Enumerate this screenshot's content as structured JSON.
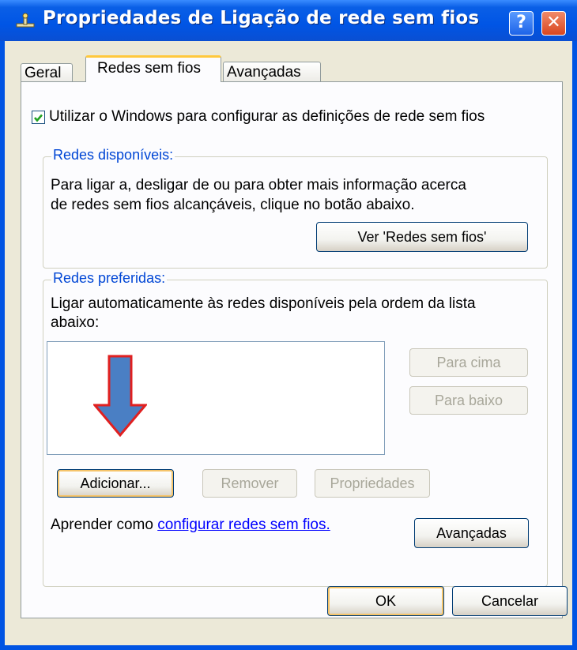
{
  "window": {
    "title": "Propriedades de Ligação de rede sem fios",
    "help_glyph": "?",
    "close_glyph": "✕"
  },
  "tabs": [
    {
      "label": "Geral"
    },
    {
      "label": "Redes sem fios"
    },
    {
      "label": "Avançadas"
    }
  ],
  "checkbox": {
    "label": "Utilizar o Windows para configurar as definições de rede sem fios",
    "checked": true
  },
  "available": {
    "legend": "Redes disponíveis:",
    "text_line1": "Para ligar a, desligar de ou para obter mais informação acerca",
    "text_line2": "de redes sem fios alcançáveis, clique no botão abaixo.",
    "view_button": "Ver 'Redes sem fios'"
  },
  "preferred": {
    "legend": "Redes preferidas:",
    "text_line1": "Ligar automaticamente às redes disponíveis pela ordem da lista",
    "text_line2": "abaixo:",
    "move_up": "Para cima",
    "move_down": "Para baixo",
    "add": "Adicionar...",
    "remove": "Remover",
    "properties": "Propriedades"
  },
  "learn": {
    "prefix": "Aprender como ",
    "link": "configurar redes sem fios."
  },
  "advanced_button": "Avançadas",
  "footer": {
    "ok": "OK",
    "cancel": "Cancelar"
  },
  "colors": {
    "title_bar": "#0055e5",
    "legend_text": "#0046d5",
    "annotation_arrow_fill": "#4a7fc4",
    "annotation_arrow_outline": "#e02020"
  }
}
